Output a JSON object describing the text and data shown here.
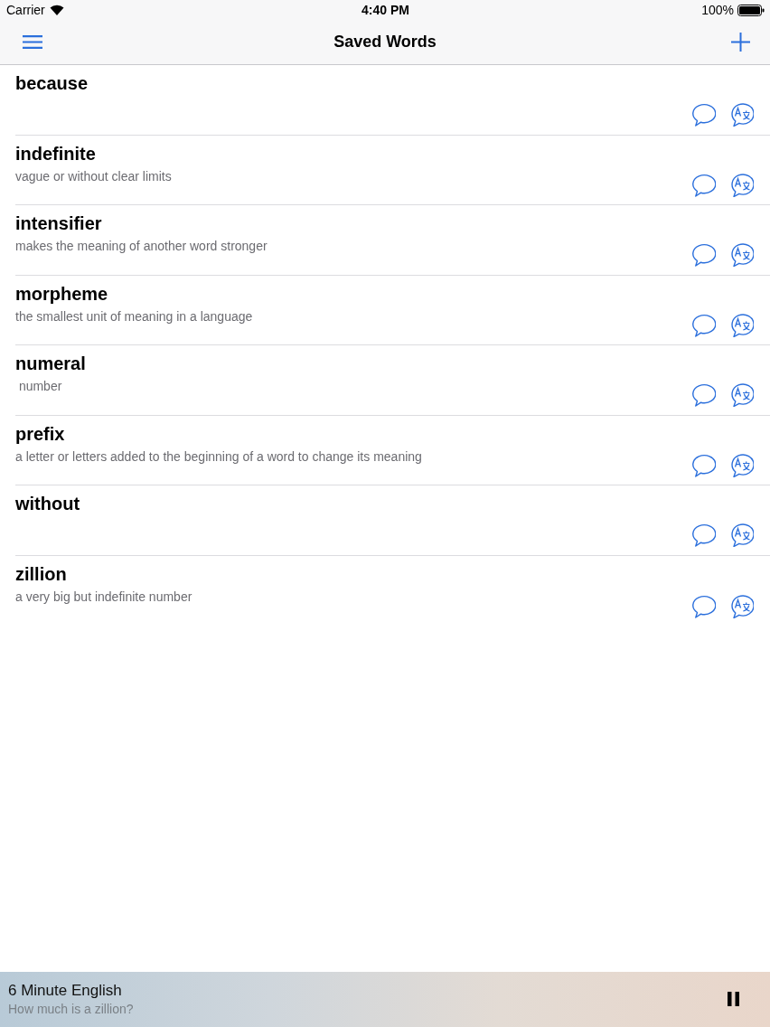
{
  "status_bar": {
    "carrier": "Carrier",
    "time": "4:40 PM",
    "battery": "100%"
  },
  "nav_bar": {
    "title": "Saved Words"
  },
  "words": [
    {
      "word": "because"
    },
    {
      "word": "indefinite",
      "definition": "vague or without clear limits"
    },
    {
      "word": "intensifier",
      "definition": "makes the meaning of another word stronger"
    },
    {
      "word": "morpheme",
      "definition": "the smallest unit of meaning in a language"
    },
    {
      "word": "numeral",
      "definition": " number"
    },
    {
      "word": "prefix",
      "definition": "a letter or letters added to the beginning of a word to change its meaning"
    },
    {
      "word": "without"
    },
    {
      "word": "zillion",
      "definition": "a very big but indefinite number"
    }
  ],
  "player": {
    "title": "6 Minute English",
    "subtitle": "How much is a zillion?",
    "playing": true
  }
}
